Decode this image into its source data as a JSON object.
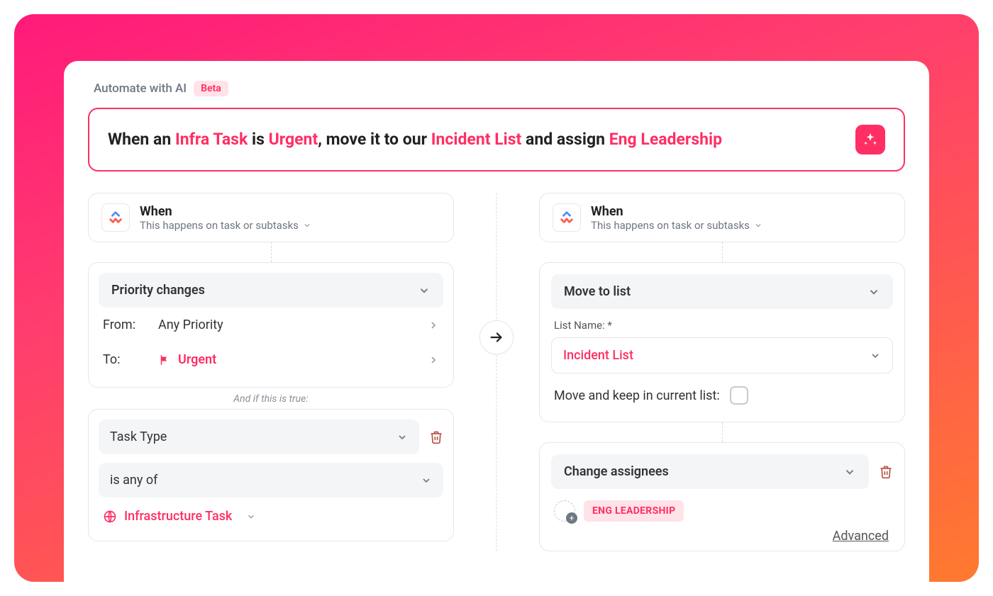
{
  "header": {
    "title": "Automate with AI",
    "badge": "Beta"
  },
  "prompt": {
    "parts": [
      {
        "t": "When an ",
        "hl": false
      },
      {
        "t": "Infra Task",
        "hl": true
      },
      {
        "t": " is ",
        "hl": false
      },
      {
        "t": "Urgent",
        "hl": true
      },
      {
        "t": ", move it to our ",
        "hl": false
      },
      {
        "t": "Incident List",
        "hl": true
      },
      {
        "t": " and assign ",
        "hl": false
      },
      {
        "t": "Eng Leadership",
        "hl": true
      }
    ]
  },
  "left": {
    "when_title": "When",
    "when_sub": "This happens on task or subtasks",
    "trigger_label": "Priority changes",
    "from_label": "From:",
    "from_value": "Any Priority",
    "to_label": "To:",
    "to_value": "Urgent",
    "cond_caption": "And if this is true:",
    "cond_field": "Task Type",
    "cond_op": "is any of",
    "cond_value": "Infrastructure Task"
  },
  "right": {
    "when_title": "When",
    "when_sub": "This happens on task or subtasks",
    "action1_label": "Move to list",
    "list_field_label": "List Name: *",
    "list_value": "Incident List",
    "keep_label": "Move and keep in current list:",
    "action2_label": "Change assignees",
    "assignee_chip": "ENG LEADERSHIP",
    "advanced": "Advanced"
  }
}
